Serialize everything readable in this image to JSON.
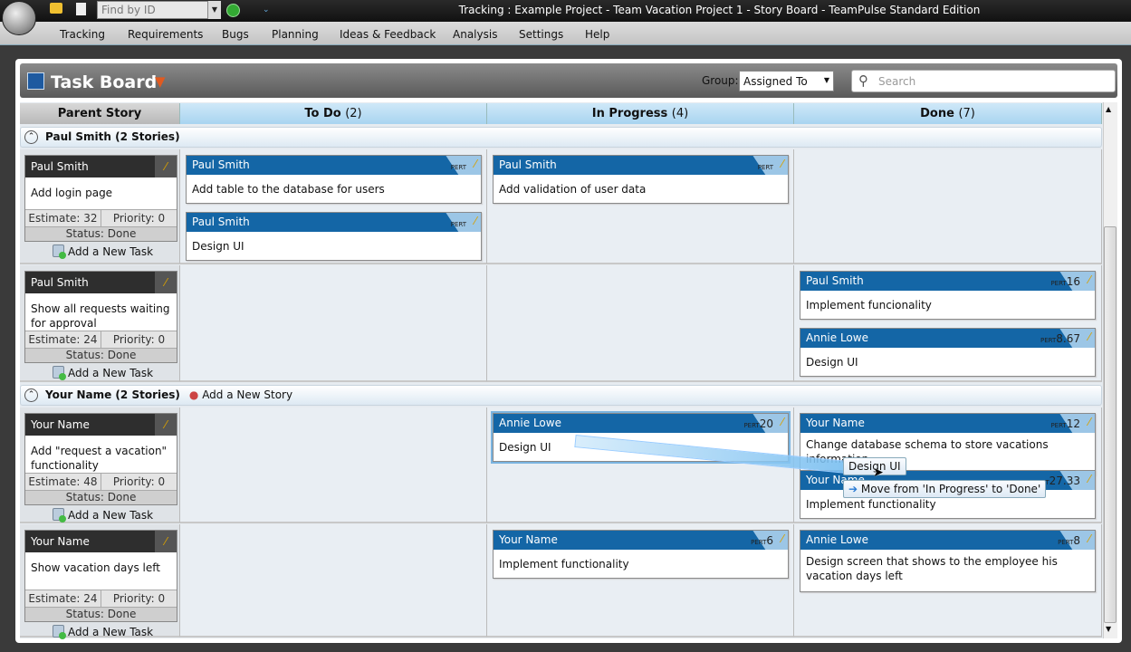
{
  "window": {
    "title": "Tracking : Example Project - Team Vacation Project 1 - Story Board  - TeamPulse Standard Edition",
    "find_placeholder": "Find by ID"
  },
  "menu": [
    "Tracking",
    "Requirements",
    "Bugs",
    "Planning",
    "Ideas & Feedback",
    "Analysis",
    "Settings",
    "Help"
  ],
  "header": {
    "title": "Task Board",
    "group_label": "Group:",
    "group_value": "Assigned To",
    "search_placeholder": "Search"
  },
  "columns": [
    {
      "label": "Parent Story",
      "count": ""
    },
    {
      "label": "To Do",
      "count": "(2)"
    },
    {
      "label": "In Progress",
      "count": "(4)"
    },
    {
      "label": "Done",
      "count": "(7)"
    }
  ],
  "groups": [
    {
      "label": "Paul Smith (2 Stories)",
      "add_story": "",
      "stories": [
        {
          "owner": "Paul Smith",
          "title": "Add login page",
          "estimate": "Estimate: 32",
          "priority": "Priority: 0",
          "status": "Status: Done",
          "add_task": "Add a New Task",
          "tasks": {
            "todo": [
              {
                "owner": "Paul Smith",
                "title": "Add table to the database for users",
                "pert": ""
              },
              {
                "owner": "Paul Smith",
                "title": "Design UI",
                "pert": ""
              }
            ],
            "inprogress": [
              {
                "owner": "Paul Smith",
                "title": "Add validation of user data",
                "pert": ""
              }
            ],
            "done": []
          }
        },
        {
          "owner": "Paul Smith",
          "title": "Show all requests waiting for approval",
          "estimate": "Estimate: 24",
          "priority": "Priority: 0",
          "status": "Status: Done",
          "add_task": "Add a New Task",
          "tasks": {
            "todo": [],
            "inprogress": [],
            "done": [
              {
                "owner": "Paul Smith",
                "title": "Implement funcionality",
                "pert": "16"
              },
              {
                "owner": "Annie Lowe",
                "title": "Design UI",
                "pert": "8.67"
              }
            ]
          }
        }
      ]
    },
    {
      "label": "Your Name (2 Stories)",
      "add_story": "Add a New Story",
      "stories": [
        {
          "owner": "Your Name",
          "title": "Add \"request a vacation\" functionality",
          "estimate": "Estimate: 48",
          "priority": "Priority: 0",
          "status": "Status: Done",
          "add_task": "Add a New Task",
          "tasks": {
            "todo": [],
            "inprogress": [
              {
                "owner": "Annie Lowe",
                "title": "Design UI",
                "pert": "20",
                "selected": true
              }
            ],
            "done": [
              {
                "owner": "Your Name",
                "title": "Change database schema to store vacations information",
                "pert": "12"
              },
              {
                "owner": "Your Name",
                "title": "Implement functionality",
                "pert": "27.33"
              }
            ]
          }
        },
        {
          "owner": "Your Name",
          "title": "Show vacation days left",
          "estimate": "Estimate: 24",
          "priority": "Priority: 0",
          "status": "Status: Done",
          "add_task": "Add a New Task",
          "tasks": {
            "todo": [],
            "inprogress": [
              {
                "owner": "Your Name",
                "title": "Implement functionality",
                "pert": "6"
              }
            ],
            "done": [
              {
                "owner": "Annie Lowe",
                "title": "Design screen that shows to the employee his vacation days left",
                "pert": "8"
              }
            ]
          }
        }
      ]
    }
  ],
  "pert_label": "PERT",
  "drag": {
    "item": "Design UI",
    "hint": "Move from 'In Progress' to 'Done'"
  },
  "colors": {
    "card_header": "#1466a6",
    "story_header": "#2e2e2e",
    "column_header": "#a8d4f0"
  }
}
